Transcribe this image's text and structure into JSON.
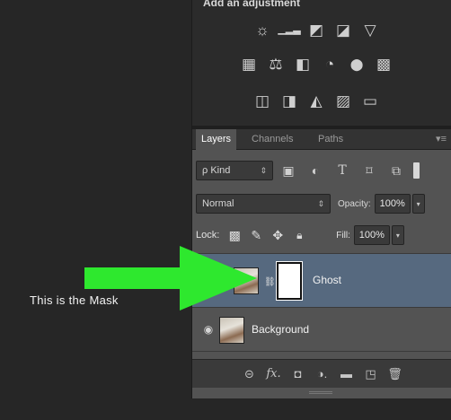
{
  "caption": {
    "mask_text": "This is the Mask"
  },
  "adjustments": {
    "title": "Add an adjustment",
    "row1": [
      {
        "name": "brightness-contrast-icon",
        "glyph": "☼"
      },
      {
        "name": "levels-icon",
        "glyph": "▁▂▃"
      },
      {
        "name": "curves-icon",
        "glyph": "◩"
      },
      {
        "name": "exposure-icon",
        "glyph": "◪"
      },
      {
        "name": "vibrance-icon",
        "glyph": "▽"
      }
    ],
    "row2": [
      {
        "name": "hue-saturation-icon",
        "glyph": "▦"
      },
      {
        "name": "color-balance-icon",
        "glyph": "⚖"
      },
      {
        "name": "black-white-icon",
        "glyph": "◧"
      },
      {
        "name": "photo-filter-icon",
        "glyph": "◔"
      },
      {
        "name": "channel-mixer-icon",
        "glyph": "⬤"
      },
      {
        "name": "color-lookup-icon",
        "glyph": "▩"
      }
    ],
    "row3": [
      {
        "name": "invert-icon",
        "glyph": "◫"
      },
      {
        "name": "posterize-icon",
        "glyph": "◨"
      },
      {
        "name": "threshold-icon",
        "glyph": "◭"
      },
      {
        "name": "gradient-map-icon",
        "glyph": "▨"
      },
      {
        "name": "selective-color-icon",
        "glyph": "▭"
      }
    ]
  },
  "tabs": {
    "layers": "Layers",
    "channels": "Channels",
    "paths": "Paths",
    "menu_glyph": "▾≡"
  },
  "filter": {
    "kind_label": "ρ Kind",
    "arrows": "⇕",
    "icons": [
      {
        "name": "pixel-filter-icon",
        "glyph": "▣"
      },
      {
        "name": "adjustment-filter-icon",
        "glyph": "◐"
      },
      {
        "name": "type-filter-icon",
        "glyph": "T"
      },
      {
        "name": "shape-filter-icon",
        "glyph": "⌑"
      },
      {
        "name": "smart-object-filter-icon",
        "glyph": "⧉"
      }
    ]
  },
  "blend": {
    "mode": "Normal",
    "arrows": "⇕",
    "opacity_label": "Opacity:",
    "opacity_value": "100%",
    "drop": "▾"
  },
  "lock": {
    "label": "Lock:",
    "icons": [
      {
        "name": "lock-transparent-icon",
        "glyph": "▩"
      },
      {
        "name": "lock-pixels-icon",
        "glyph": "✎"
      },
      {
        "name": "lock-position-icon",
        "glyph": "✥"
      },
      {
        "name": "lock-all-icon",
        "glyph": "🔒︎"
      }
    ],
    "fill_label": "Fill:",
    "fill_value": "100%",
    "drop": "▾"
  },
  "layers": [
    {
      "name": "Ghost",
      "visible": false,
      "selected": true,
      "has_mask": true
    },
    {
      "name": "Background",
      "visible": true,
      "selected": false,
      "has_mask": false
    }
  ],
  "glyphs": {
    "eye": "◉",
    "chain": "⛓"
  },
  "footer": [
    {
      "name": "link-layers-icon",
      "glyph": "⊝"
    },
    {
      "name": "fx-icon",
      "glyph": "fx."
    },
    {
      "name": "add-mask-icon",
      "glyph": "◘"
    },
    {
      "name": "adjustment-layer-icon",
      "glyph": "◑."
    },
    {
      "name": "group-folder-icon",
      "glyph": "▬"
    },
    {
      "name": "new-layer-icon",
      "glyph": "◳"
    },
    {
      "name": "trash-icon",
      "glyph": "🗑︎"
    }
  ],
  "colors": {
    "arrow": "#2ee82e",
    "selected_layer": "#56697f",
    "panel": "#535353"
  }
}
